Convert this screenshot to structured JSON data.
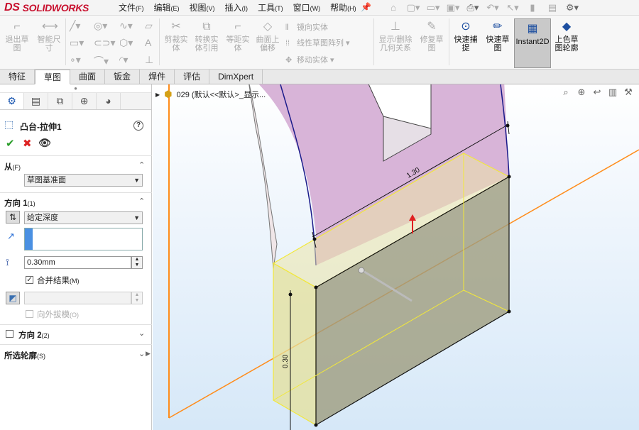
{
  "app": {
    "logo_prefix": "DS",
    "logo_name": "SOLIDWORKS"
  },
  "menu": [
    {
      "label": "文件",
      "key": "(F)"
    },
    {
      "label": "编辑",
      "key": "(E)"
    },
    {
      "label": "视图",
      "key": "(V)"
    },
    {
      "label": "插入",
      "key": "(I)"
    },
    {
      "label": "工具",
      "key": "(T)"
    },
    {
      "label": "窗口",
      "key": "(W)"
    },
    {
      "label": "帮助",
      "key": "(H)"
    }
  ],
  "quick_access_icons": [
    "home-icon",
    "new-icon",
    "open-icon",
    "save-icon",
    "print-icon",
    "undo-icon",
    "select-icon",
    "rebuild-icon",
    "file-properties-icon",
    "options-icon"
  ],
  "ribbon": {
    "exit_sketch": "退出草图",
    "smart_dimension": "智能尺寸",
    "trim": "剪裁实体",
    "convert": "转换实体引用",
    "offset": "等距实体",
    "offset_surface": "曲面上偏移",
    "mirror": "镜向实体",
    "linear_pattern": "线性草图阵列",
    "move": "移动实体",
    "display_delete": "显示/删除几何关系",
    "repair": "修复草图",
    "rapid_snap": "快速捕捉",
    "rapid_sketch": "快速草图",
    "instant2d": "Instant2D",
    "shaded_contours": "上色草图轮廓"
  },
  "tabs": [
    "特征",
    "草图",
    "曲面",
    "钣金",
    "焊件",
    "评估",
    "DimXpert"
  ],
  "active_tab": "草图",
  "property_manager": {
    "feature_title": "凸台-拉伸1",
    "from_label": "从",
    "from_key": "(F)",
    "from_value": "草图基准面",
    "dir1_label": "方向 1",
    "dir1_key": "(1)",
    "end_condition": "给定深度",
    "depth_value": "0.30mm",
    "merge_label": "合并结果",
    "merge_key": "(M)",
    "merge_checked": true,
    "draft_label": "向外拔模",
    "draft_key": "(O)",
    "dir2_label": "方向 2",
    "dir2_key": "(2)",
    "contours_label": "所选轮廓",
    "contours_key": "(S)"
  },
  "viewport": {
    "tree_item": "029  (默认<<默认>_显示..."
  },
  "dimensions": {
    "length_label": "1.30",
    "height_label": "0.30"
  },
  "colors": {
    "accent_red": "#c8102e",
    "preview_yellow": "#f2e83a",
    "sketch_blue": "#1a1a8a",
    "plane_orange": "#ff8c1a",
    "part_pink": "#d8b4d8"
  }
}
